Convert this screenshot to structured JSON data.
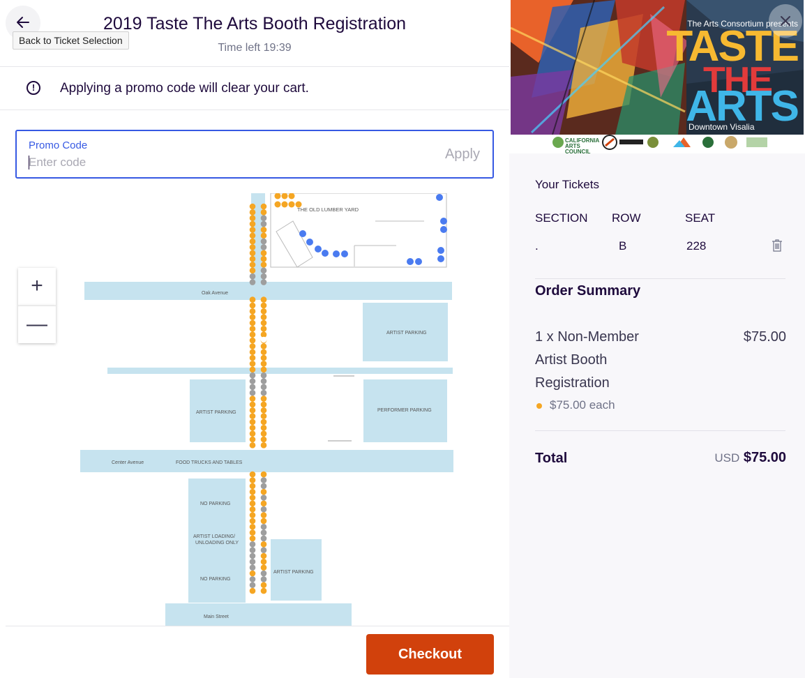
{
  "header": {
    "title": "2019 Taste The Arts Booth Registration",
    "timer": "Time left 19:39",
    "back_tooltip": "Back to Ticket Selection"
  },
  "notice": {
    "text": "Applying a promo code will clear your cart."
  },
  "promo": {
    "label": "Promo Code",
    "placeholder": "Enter code",
    "value": "",
    "apply_label": "Apply"
  },
  "map": {
    "zoom_in": "+",
    "zoom_out": "—",
    "labels": {
      "old_lumber_yard": "THE OLD LUMBER YARD",
      "oak_avenue": "Oak Avenue",
      "artist_parking": "ARTIST PARKING",
      "performer_parking": "PERFORMER PARKING",
      "center_avenue": "Center Avenue",
      "food_trucks": "FOOD TRUCKS AND TABLES",
      "no_parking": "NO PARKING",
      "artist_loading_1": "ARTIST LOADING/",
      "artist_loading_2": "UNLOADING ONLY",
      "main_street": "Main Street"
    },
    "colors": {
      "road": "#c6e3ef",
      "available_seat": "#f5a623",
      "unavailable_seat": "#9e9e9e",
      "other_seat": "#4a7bf0"
    }
  },
  "checkout": {
    "label": "Checkout"
  },
  "banner": {
    "brand": "The Arts Consortium presents",
    "taste": "TASTE",
    "the": "THE",
    "arts": "ARTS",
    "city": "Downtown Visalia",
    "sponsor": "CALIFORNIA ARTS COUNCIL"
  },
  "tickets": {
    "title": "Your Tickets",
    "columns": [
      "SECTION",
      "ROW",
      "SEAT"
    ],
    "row": {
      "section": ".",
      "row": "B",
      "seat": "228"
    }
  },
  "order": {
    "title": "Order Summary",
    "item_name": "1 x Non-Member Artist Booth Registration",
    "item_price": "$75.00",
    "each": "$75.00 each",
    "total_label": "Total",
    "total_currency": "USD",
    "total_amount": "$75.00"
  },
  "colors": {
    "brand_orange": "#d1410c",
    "focus_blue": "#3659e3",
    "text_dark": "#1e0a3c",
    "text_muted": "#6f7287"
  }
}
